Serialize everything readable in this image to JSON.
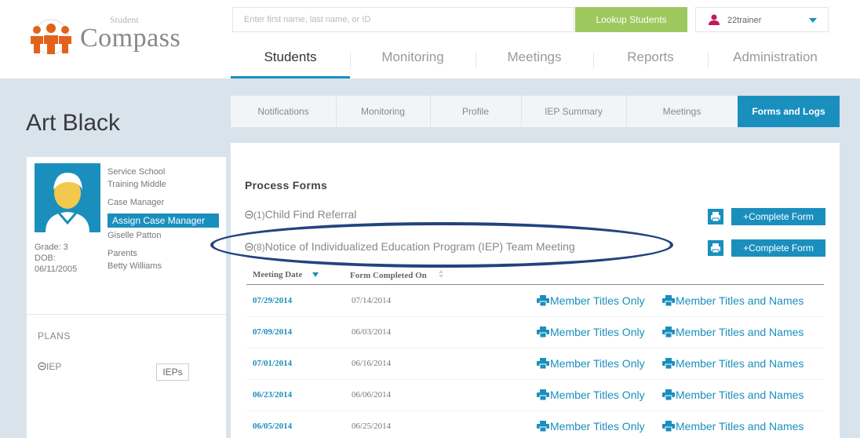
{
  "logo": {
    "student": "Student",
    "compass": "Compass"
  },
  "search": {
    "placeholder": "Enter first name, last name, or ID",
    "button": "Lookup Students"
  },
  "user": {
    "name": "22trainer"
  },
  "nav": {
    "students": "Students",
    "monitoring": "Monitoring",
    "meetings": "Meetings",
    "reports": "Reports",
    "administration": "Administration"
  },
  "student": {
    "name": "Art Black",
    "service_school_label": "Service School",
    "service_school": "Training Middle",
    "case_manager_label": "Case Manager",
    "assign_case_manager": "Assign Case Manager",
    "case_manager": "Giselle Patton",
    "parents_label": "Parents",
    "parent": "Betty Williams",
    "grade": "Grade: 3",
    "dob_label": "DOB:",
    "dob": "06/11/2005"
  },
  "plans": {
    "title": "PLANS",
    "iep": "IEP",
    "ieps_button": "IEPs"
  },
  "tabs": {
    "notifications": "Notifications",
    "monitoring": "Monitoring",
    "profile": "Profile",
    "iep_summary": "IEP Summary",
    "meetings": "Meetings",
    "forms_and_logs": "Forms and Logs"
  },
  "process_forms": {
    "title": "Process Forms",
    "forms": [
      {
        "prefix": "(1)",
        "name": "Child Find Referral",
        "complete_label": "+Complete Form"
      },
      {
        "prefix": "(8)",
        "name": "Notice of Individualized Education Program (IEP) Team Meeting",
        "complete_label": "+Complete Form"
      }
    ]
  },
  "table": {
    "col_meeting_date": "Meeting Date",
    "col_form_completed": "Form Completed On",
    "link_titles_only": "Member Titles Only",
    "link_titles_names": "Member Titles and Names",
    "rows": [
      {
        "meeting_date": "07/29/2014",
        "completed_on": "07/14/2014"
      },
      {
        "meeting_date": "07/09/2014",
        "completed_on": "06/03/2014"
      },
      {
        "meeting_date": "07/01/2014",
        "completed_on": "06/16/2014"
      },
      {
        "meeting_date": "06/23/2014",
        "completed_on": "06/06/2014"
      },
      {
        "meeting_date": "06/05/2014",
        "completed_on": "06/25/2014"
      }
    ]
  },
  "colors": {
    "accent": "#1a8fbd",
    "lookup": "#9dc85e",
    "annotation": "#22437e"
  }
}
